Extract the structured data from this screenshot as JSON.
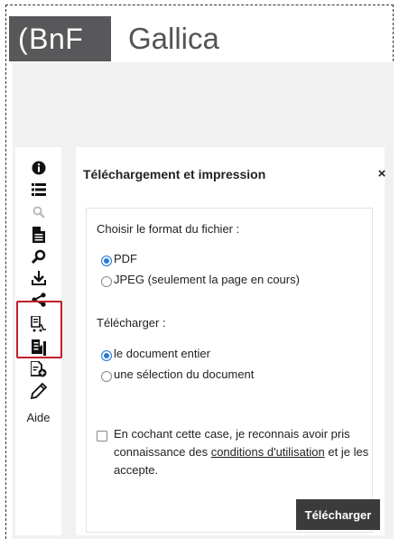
{
  "brand": {
    "logo_bracket": "(",
    "logo_text": "BnF",
    "app_name": "Gallica"
  },
  "sidebar": {
    "items": [
      {
        "icon": "info-icon"
      },
      {
        "icon": "list-icon"
      },
      {
        "icon": "search-icon"
      },
      {
        "icon": "document-icon"
      },
      {
        "icon": "search-doc-icon"
      },
      {
        "icon": "download-icon"
      },
      {
        "icon": "share-icon"
      },
      {
        "icon": "cart-icon"
      },
      {
        "icon": "bookmark-doc-icon"
      },
      {
        "icon": "add-doc-icon"
      },
      {
        "icon": "pencil-icon"
      }
    ],
    "help_label": "Aide"
  },
  "panel": {
    "title": "Téléchargement et impression",
    "close_symbol": "×",
    "format_label": "Choisir le format du fichier :",
    "format_options": [
      "PDF",
      "JPEG (seulement la page en cours)"
    ],
    "download_label": "Télécharger :",
    "download_options": [
      "le document entier",
      "une sélection du document"
    ],
    "terms_prefix": "En cochant cette case, je reconnais avoir pris",
    "terms_mid": "connaissance des",
    "terms_link": "conditions d'utilisation",
    "terms_suffix": "et je les",
    "terms_end": "accepte.",
    "download_button": "Télécharger"
  },
  "colors": {
    "accent": "#2a7bd6",
    "highlight": "#c01f2a",
    "logo_bg": "#58585a"
  }
}
